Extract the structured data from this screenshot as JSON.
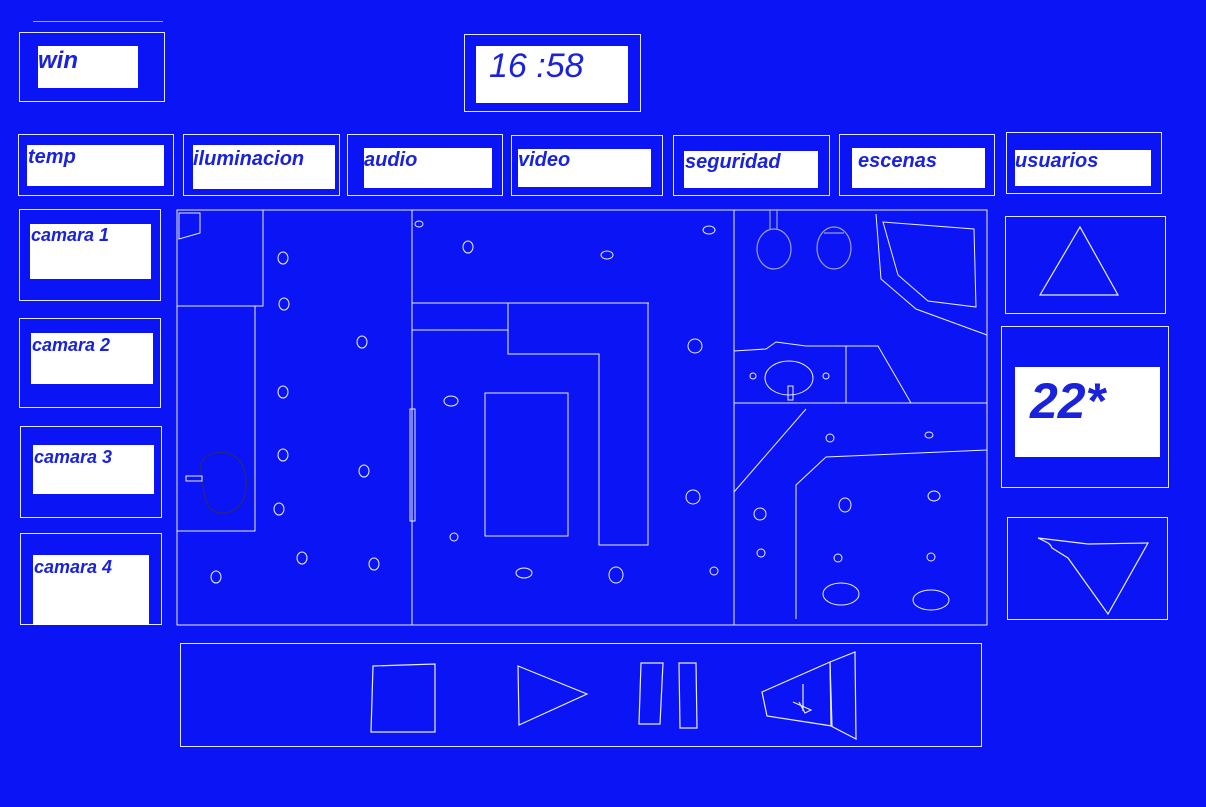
{
  "header": {
    "win_label": "win",
    "clock_time": "16 :58"
  },
  "tabs": [
    {
      "label": "temp"
    },
    {
      "label": "iluminacion"
    },
    {
      "label": "audio"
    },
    {
      "label": "video"
    },
    {
      "label": "seguridad"
    },
    {
      "label": "escenas"
    },
    {
      "label": "usuarios"
    }
  ],
  "cameras": [
    {
      "label": "camara 1"
    },
    {
      "label": "camara 2"
    },
    {
      "label": "camara 3"
    },
    {
      "label": "camara 4"
    }
  ],
  "thermostat": {
    "temperature": "22*",
    "up_icon": "triangle-up-icon",
    "down_icon": "triangle-down-icon"
  },
  "media_controls": {
    "icons": [
      "stop-icon",
      "play-icon",
      "pause-icon",
      "volume-icon"
    ]
  },
  "floorplan": {
    "icon": "floorplan-icon"
  },
  "colors": {
    "background": "#0a14f4",
    "panel": "#ffffff",
    "text": "#1a23d9",
    "lines": "#dfe6ff"
  }
}
